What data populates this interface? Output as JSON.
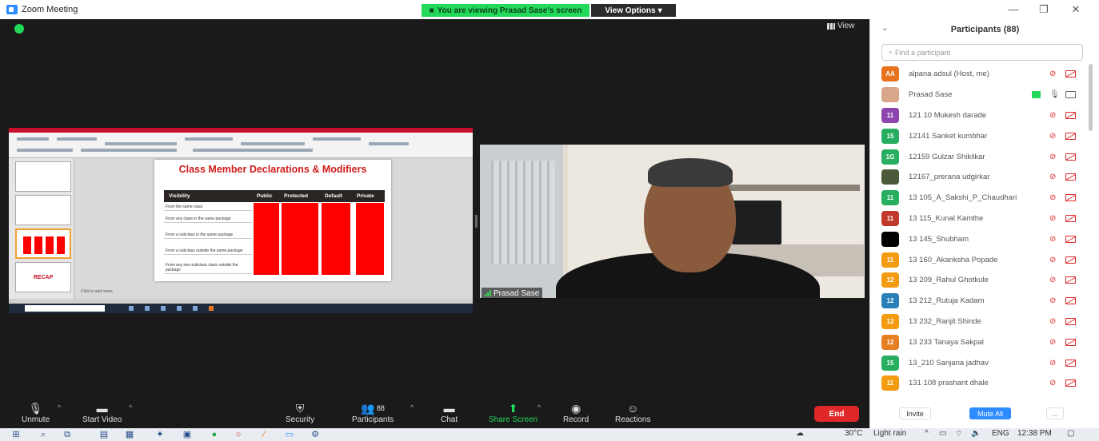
{
  "titlebar": {
    "app_title": "Zoom Meeting",
    "viewing_banner": "You are viewing Prasad Sase's screen",
    "view_options": "View Options",
    "minimize": "—",
    "restore": "❐",
    "close": "✕"
  },
  "meeting": {
    "view_label": "View",
    "camera_name": "Prasad Sase"
  },
  "slide": {
    "title": "Class Member Declarations & Modifiers",
    "headers": [
      "Visibility",
      "Public",
      "Protected",
      "Default",
      "Private"
    ],
    "rows": [
      "From the same class",
      "From any class in the same package",
      "From a subclass in the same package",
      "From a subclass outside the same package",
      "From any non-subclass class outside the package"
    ],
    "recap": "RECAP",
    "notes": "Click to add notes",
    "search_placeholder": "Type here to search"
  },
  "toolbar": {
    "unmute": "Unmute",
    "start_video": "Start Video",
    "security": "Security",
    "participants": "Participants",
    "participants_count": "88",
    "chat": "Chat",
    "share_screen": "Share Screen",
    "record": "Record",
    "reactions": "Reactions",
    "end": "End"
  },
  "panel": {
    "title": "Participants (88)",
    "search_placeholder": "Find a participant",
    "invite": "Invite",
    "mute_all": "Mute All",
    "more": "...",
    "participants": [
      {
        "initials": "AA",
        "color": "#e8731e",
        "name": "alpana adsul (Host, me)",
        "mic": "muted",
        "video": "off"
      },
      {
        "initials": "",
        "color": "#d9a68a",
        "name": "Prasad Sase",
        "mic": "on",
        "video": "on",
        "sharing": true
      },
      {
        "initials": "11",
        "color": "#8e44ad",
        "name": "121 10 Mukesh darade",
        "mic": "muted",
        "video": "off"
      },
      {
        "initials": "15",
        "color": "#27ae60",
        "name": "12141 Sanket kumbhar",
        "mic": "muted",
        "video": "off"
      },
      {
        "initials": "1G",
        "color": "#27ae60",
        "name": "12159 Gulzar Shikilkar",
        "mic": "muted",
        "video": "off"
      },
      {
        "initials": "",
        "color": "#4a5a3a",
        "name": "12167_prerana udgirkar",
        "mic": "muted",
        "video": "off"
      },
      {
        "initials": "11",
        "color": "#27ae60",
        "name": "13 105_A_Sakshi_P_Chaudhari",
        "mic": "muted",
        "video": "off"
      },
      {
        "initials": "11",
        "color": "#c0392b",
        "name": "13 115_Kunal Kamthe",
        "mic": "muted",
        "video": "off"
      },
      {
        "initials": "",
        "color": "#000000",
        "name": "13 145_Shubham",
        "mic": "muted",
        "video": "off"
      },
      {
        "initials": "11",
        "color": "#f39c12",
        "name": "13 160_Akanksha Popade",
        "mic": "muted",
        "video": "off"
      },
      {
        "initials": "12",
        "color": "#f39c12",
        "name": "13 209_Rahul Ghotkule",
        "mic": "muted",
        "video": "off"
      },
      {
        "initials": "12",
        "color": "#2980b9",
        "name": "13 212_Rutuja Kadam",
        "mic": "muted",
        "video": "off"
      },
      {
        "initials": "12",
        "color": "#f39c12",
        "name": "13 232_Ranjit Shinde",
        "mic": "muted",
        "video": "off"
      },
      {
        "initials": "12",
        "color": "#e67e22",
        "name": "13 233 Tanaya Sakpal",
        "mic": "muted",
        "video": "off"
      },
      {
        "initials": "15",
        "color": "#27ae60",
        "name": "13_210 Sanjana jadhav",
        "mic": "muted",
        "video": "off"
      },
      {
        "initials": "11",
        "color": "#f39c12",
        "name": "131 108 prashant dhale",
        "mic": "muted",
        "video": "off"
      }
    ]
  },
  "taskbar": {
    "temperature": "30°C",
    "weather": "Light rain",
    "lang": "ENG",
    "time": "12:38 PM"
  }
}
